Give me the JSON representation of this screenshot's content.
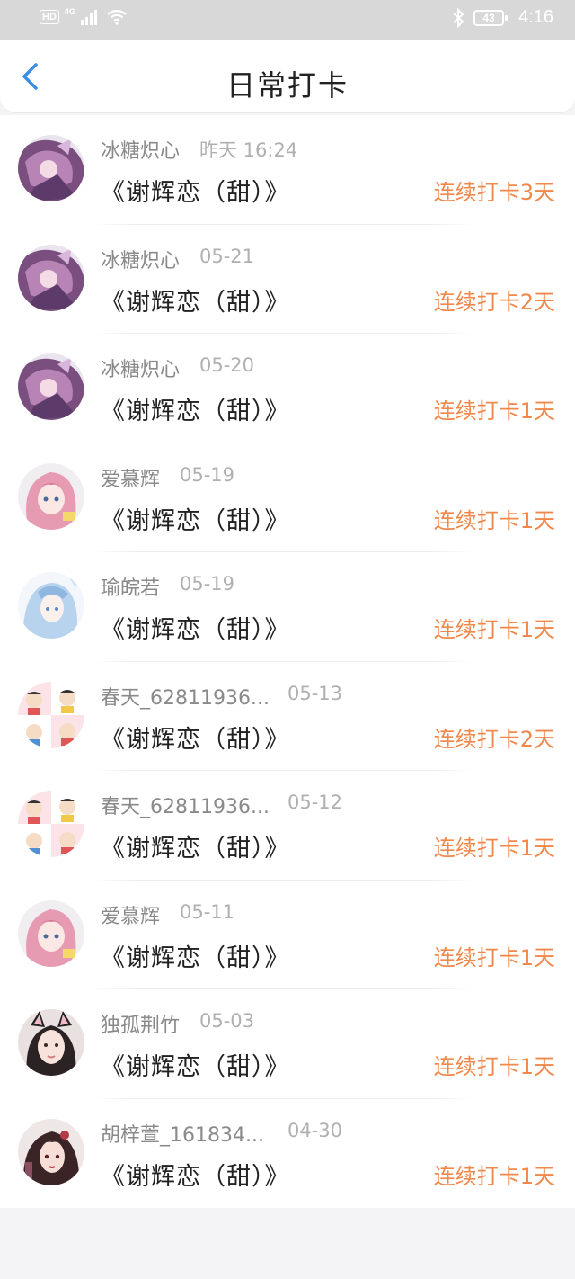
{
  "statusbar": {
    "left_badge": "HD",
    "network": "4G",
    "battery": "43",
    "time": "4:16",
    "icons": [
      "signal-icon",
      "wifi-icon",
      "bluetooth-icon",
      "battery-icon"
    ]
  },
  "nav": {
    "title": "日常打卡",
    "back_icon": "chevron-left-icon",
    "accent": "#3a8ee6"
  },
  "colors": {
    "streak": "#f0884c",
    "name": "#8a8a8a",
    "date": "#b0b0b0",
    "book": "#222222"
  },
  "checkins": [
    {
      "name": "冰糖炽心",
      "date": "昨天 16:24",
      "book": "《谢辉恋（甜）》",
      "streak": "连续打卡3天",
      "avatar": "purple-anime-avatar"
    },
    {
      "name": "冰糖炽心",
      "date": "05-21",
      "book": "《谢辉恋（甜）》",
      "streak": "连续打卡2天",
      "avatar": "purple-anime-avatar"
    },
    {
      "name": "冰糖炽心",
      "date": "05-20",
      "book": "《谢辉恋（甜）》",
      "streak": "连续打卡1天",
      "avatar": "purple-anime-avatar"
    },
    {
      "name": "爱慕辉",
      "date": "05-19",
      "book": "《谢辉恋（甜）》",
      "streak": "连续打卡1天",
      "avatar": "pink-hair-avatar"
    },
    {
      "name": "瑜皖若",
      "date": "05-19",
      "book": "《谢辉恋（甜）》",
      "streak": "连续打卡1天",
      "avatar": "blue-hair-avatar"
    },
    {
      "name": "春天_62811936...",
      "date": "05-13",
      "book": "《谢辉恋（甜）》",
      "streak": "连续打卡2天",
      "avatar": "cartoon-grid-avatar"
    },
    {
      "name": "春天_62811936...",
      "date": "05-12",
      "book": "《谢辉恋（甜）》",
      "streak": "连续打卡1天",
      "avatar": "cartoon-grid-avatar"
    },
    {
      "name": "爱慕辉",
      "date": "05-11",
      "book": "《谢辉恋（甜）》",
      "streak": "连续打卡1天",
      "avatar": "pink-hair-avatar"
    },
    {
      "name": "独孤荆竹",
      "date": "05-03",
      "book": "《谢辉恋（甜）》",
      "streak": "连续打卡1天",
      "avatar": "cat-ear-girl-avatar"
    },
    {
      "name": "胡梓萱_161834...",
      "date": "04-30",
      "book": "《谢辉恋（甜）》",
      "streak": "连续打卡1天",
      "avatar": "dark-hair-avatar"
    }
  ]
}
